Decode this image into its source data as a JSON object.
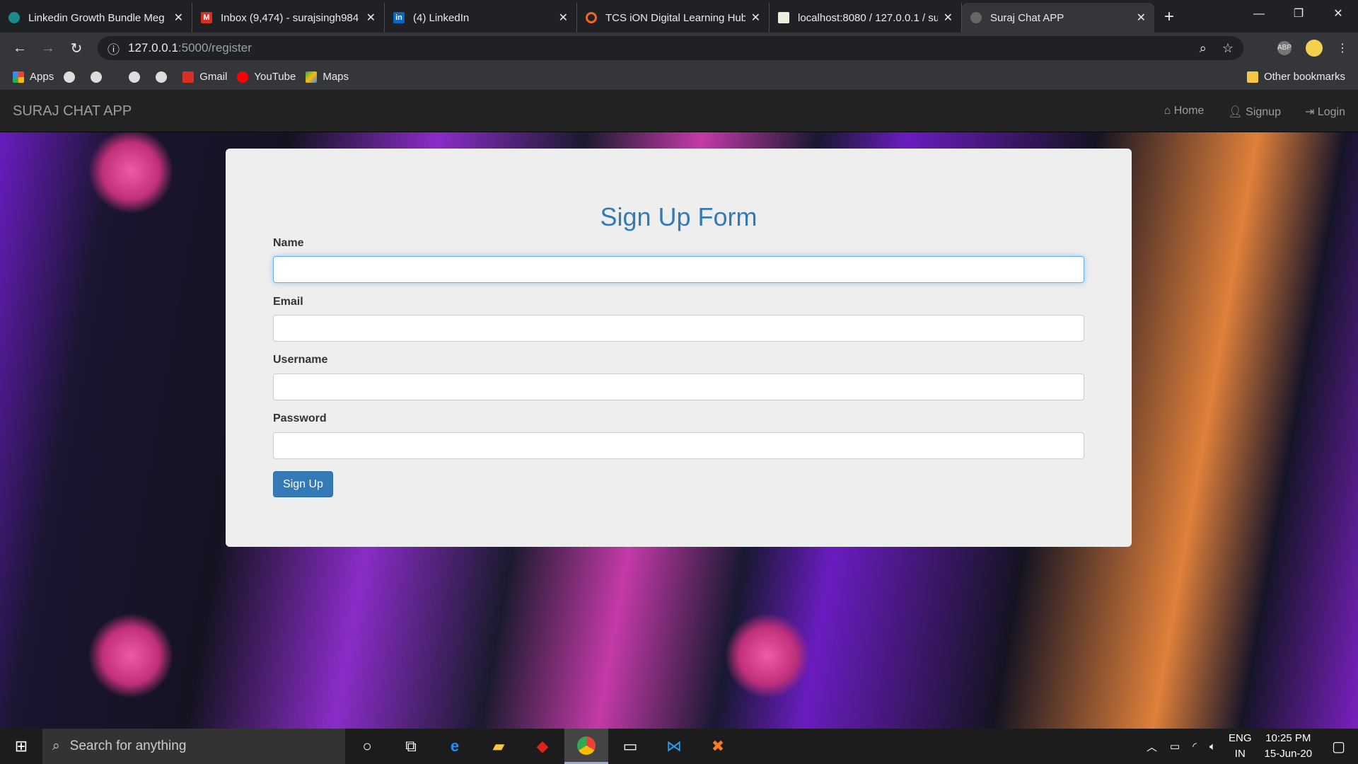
{
  "browser": {
    "tabs": [
      {
        "title": "Linkedin Growth Bundle Meg",
        "color": "#1a8a8a"
      },
      {
        "title": "Inbox (9,474) - surajsingh984",
        "color": "#d93025"
      },
      {
        "title": "(4) LinkedIn",
        "color": "#0a66c2"
      },
      {
        "title": "TCS iON Digital Learning Hub",
        "color": "#f26522"
      },
      {
        "title": "localhost:8080 / 127.0.0.1 / su",
        "color": "#cc9"
      },
      {
        "title": "Suraj Chat APP",
        "color": "#777"
      }
    ],
    "url_host": "127.0.0.1",
    "url_rest": ":5000/register",
    "bookmarks": [
      {
        "label": "Apps"
      },
      {
        "label": "Gmail"
      },
      {
        "label": "YouTube"
      },
      {
        "label": "Maps"
      }
    ],
    "other_bookmarks": "Other bookmarks"
  },
  "navbar": {
    "brand": "SURAJ CHAT APP",
    "links": [
      "Home",
      "Signup",
      "Login"
    ]
  },
  "form": {
    "title": "Sign Up Form",
    "fields": [
      {
        "label": "Name",
        "value": ""
      },
      {
        "label": "Email",
        "value": ""
      },
      {
        "label": "Username",
        "value": ""
      },
      {
        "label": "Password",
        "value": ""
      }
    ],
    "submit": "Sign Up"
  },
  "taskbar": {
    "search_placeholder": "Search for anything",
    "lang1": "ENG",
    "lang2": "IN",
    "time": "10:25 PM",
    "date": "15-Jun-20"
  }
}
